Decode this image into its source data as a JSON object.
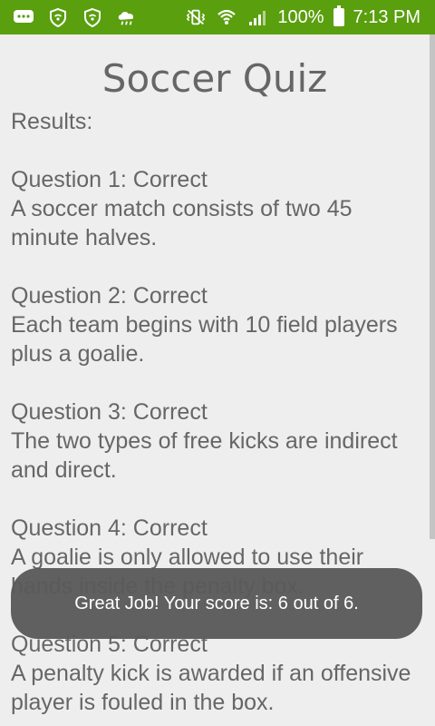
{
  "status_bar": {
    "battery_percent": "100%",
    "time": "7:13 PM",
    "background": "#5a9f0e"
  },
  "title": "Soccer Quiz",
  "results_label": "Results:",
  "questions": [
    {
      "header": "Question 1: Correct",
      "text": "A soccer match consists of two 45 minute halves."
    },
    {
      "header": "Question 2: Correct",
      "text": "Each team begins with 10 field players plus a goalie."
    },
    {
      "header": "Question 3: Correct",
      "text": "The two types of free kicks are indirect and direct."
    },
    {
      "header": "Question 4: Correct",
      "text": "A goalie is only allowed to use their hands inside the penalty box."
    },
    {
      "header": "Question 5: Correct",
      "text": "A penalty kick is awarded if an offensive player is fouled in the box."
    }
  ],
  "toast": "Great Job! Your score is: 6 out of 6."
}
